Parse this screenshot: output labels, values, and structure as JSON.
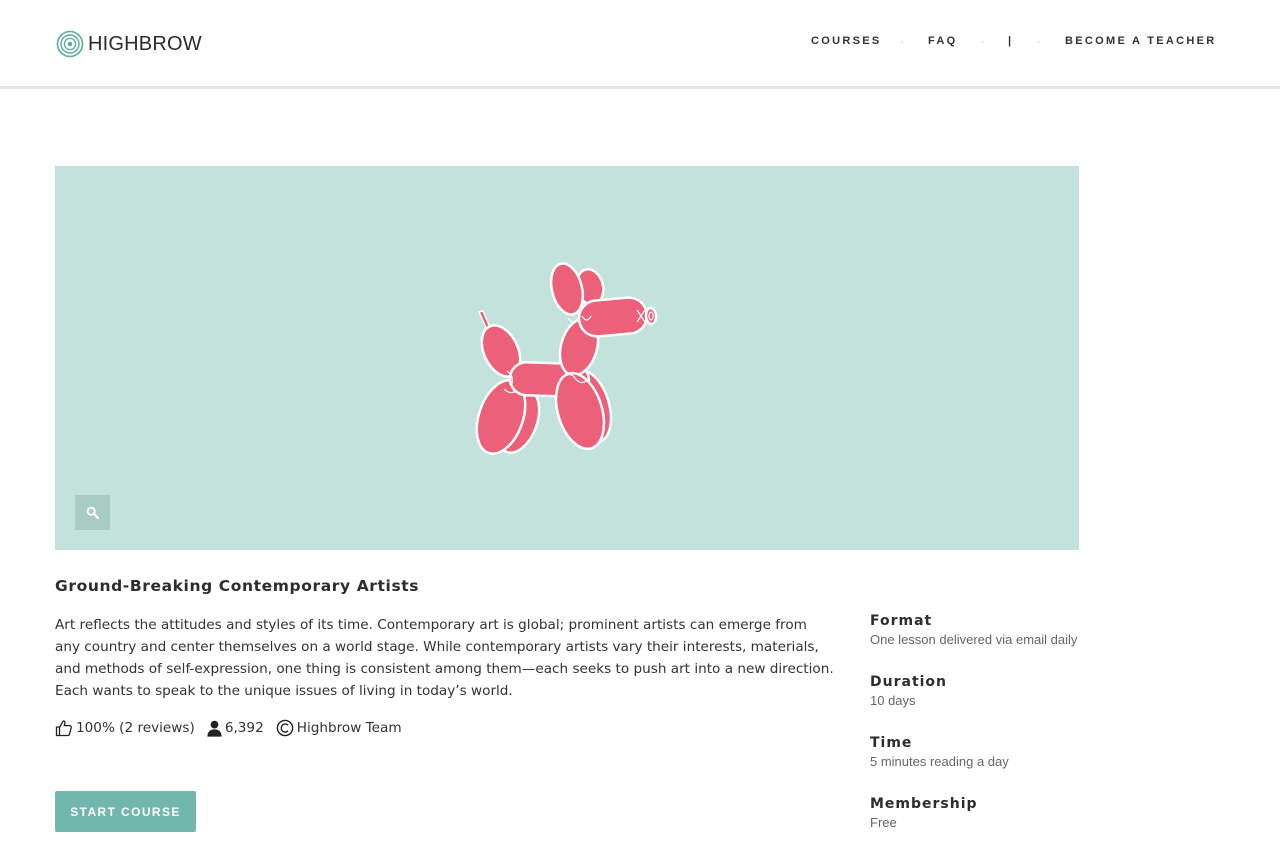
{
  "header": {
    "logo_text": "HIGHBROW",
    "nav": {
      "courses": "COURSES",
      "faq": "FAQ",
      "separator": "|",
      "become_teacher": "BECOME A TEACHER"
    }
  },
  "hero": {
    "background_color": "#c3e2db",
    "illustration": "balloon-dog",
    "illustration_color": "#ec6079",
    "zoom_icon": "search-icon"
  },
  "course": {
    "title": "Ground-Breaking Contemporary Artists",
    "description": "Art reflects the attitudes and styles of its time. Contemporary art is global; prominent artists can emerge from any country and center themselves on a world stage. While contemporary artists vary their interests, materials, and methods of self-expression, one thing is consistent among them—each seeks to push art into a new direction. Each wants to speak to the unique issues of living in today’s world.",
    "rating": "100% (2 reviews)",
    "students": "6,392",
    "author": "Highbrow Team",
    "start_label": "START COURSE"
  },
  "info": {
    "format": {
      "label": "Format",
      "value": "One lesson delivered via email daily"
    },
    "duration": {
      "label": "Duration",
      "value": "10 days"
    },
    "time": {
      "label": "Time",
      "value": "5 minutes reading a day"
    },
    "membership": {
      "label": "Membership",
      "value": "Free"
    }
  },
  "colors": {
    "accent": "#71b7ad",
    "logo": "#5aaa9e"
  }
}
